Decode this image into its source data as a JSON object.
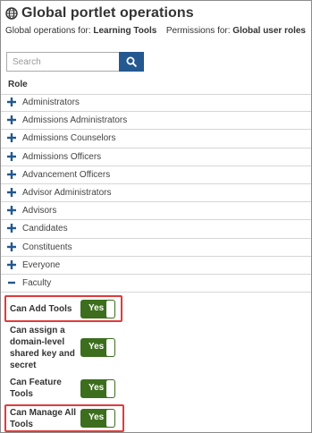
{
  "header": {
    "title": "Global portlet operations",
    "ops_prefix": "Global operations for: ",
    "ops_value": "Learning Tools",
    "perm_prefix": "Permissions for: ",
    "perm_value": "Global user roles"
  },
  "search": {
    "placeholder": "Search"
  },
  "table": {
    "role_header": "Role"
  },
  "roles": [
    "Administrators",
    "Admissions Administrators",
    "Admissions Counselors",
    "Admissions Officers",
    "Advancement Officers",
    "Advisor Administrators",
    "Advisors",
    "Candidates",
    "Constituents",
    "Everyone",
    "Faculty"
  ],
  "permissions": [
    {
      "label": "Can Add Tools",
      "value": "Yes",
      "highlighted": true
    },
    {
      "label": "Can assign a domain-level shared key and secret",
      "value": "Yes",
      "highlighted": false
    },
    {
      "label": "Can Feature Tools",
      "value": "Yes",
      "highlighted": false
    },
    {
      "label": "Can Manage All Tools",
      "value": "Yes",
      "highlighted": true
    }
  ],
  "colors": {
    "accent": "#235890",
    "toggle_on": "#3c6e1e",
    "highlight": "#e23a3a",
    "plus": "#235890"
  }
}
